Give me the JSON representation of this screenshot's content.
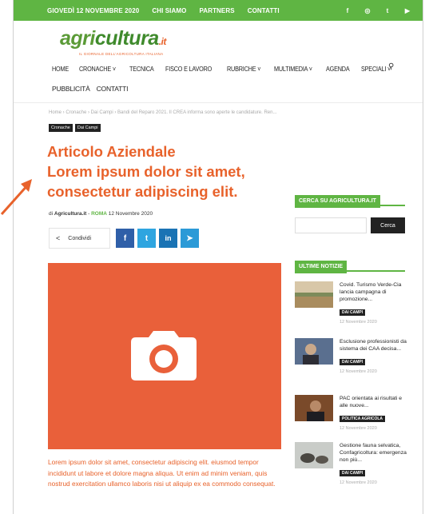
{
  "topbar": {
    "date": "GIOVEDÌ 12 NOVEMBRE 2020",
    "links": [
      "CHI SIAMO",
      "PARTNERS",
      "CONTATTI"
    ],
    "social": [
      "facebook-icon",
      "instagram-icon",
      "twitter-icon",
      "youtube-icon"
    ],
    "social_glyphs": [
      "f",
      "◎",
      "t",
      "▶"
    ],
    "color": "#5fb543"
  },
  "logo": {
    "part1": "agri",
    "part2": "cultura",
    "part3": ".it",
    "tagline": "IL GIORNALE DELL'AGRICOLTURA ITALIANA"
  },
  "nav": {
    "row1": [
      "HOME",
      "CRONACHE ˅",
      "TECNICA",
      "FISCO E LAVORO",
      "RUBRICHE ˅",
      "MULTIMEDIA ˅",
      "AGENDA",
      "SPECIALI ˅"
    ],
    "row2": [
      "PUBBLICITÀ",
      "CONTATTI"
    ],
    "search_glyph": "⚲"
  },
  "article": {
    "breadcrumb": "Home  ›  Cronache  ›  Dai Campi  ›  Bandi del Reparo 2021. Il CREA informa sono aperte le candidature. Ren...",
    "tags": [
      "Cronache",
      "Dai Campi"
    ],
    "title_lines": [
      "Articolo Aziendale",
      "Lorem ipsum dolor sit amet,",
      "consectetur adipiscing elit."
    ],
    "by": "di ",
    "author": "Agricultura.it",
    "sep": " - ",
    "place": "ROMA",
    "date": " 12 Novembre 2020",
    "share_label": "Condividi",
    "share_glyph": "<",
    "share_buttons": [
      "f",
      "t",
      "in",
      "➤"
    ],
    "caption": "Lorem ipsum dolor sit amet, consectetur adipiscing elit. eiusmod tempor incididunt ut labore et dolore magna aliqua. Ut enim ad minim veniam, quis nostrud exercitation ullamco laboris nisi ut aliquip ex ea commodo consequat.",
    "accent_color": "#e8622b",
    "hero_color": "#e9603a"
  },
  "sidebar": {
    "search_heading": "CERCA SU AGRICULTURA.IT",
    "search_button": "Cerca",
    "news_heading": "ULTIME NOTIZIE",
    "news": [
      {
        "title": "Covid. Turismo Verde-Cia lancia campagna di promozione...",
        "category": "DAI CAMPI",
        "date": "12 Novembre 2020"
      },
      {
        "title": "Esclusione professionisti da sistema dei CAA decisa...",
        "category": "DAI CAMPI",
        "date": "12 Novembre 2020"
      },
      {
        "title": "PAC orientata ai risultati e alle nuove...",
        "category": "POLITICA AGRICOLA",
        "date": "12 Novembre 2020"
      },
      {
        "title": "Gestione fauna selvatica, Confagricoltura: emergenza non più...",
        "category": "DAI CAMPI",
        "date": "12 Novembre 2020"
      }
    ]
  }
}
